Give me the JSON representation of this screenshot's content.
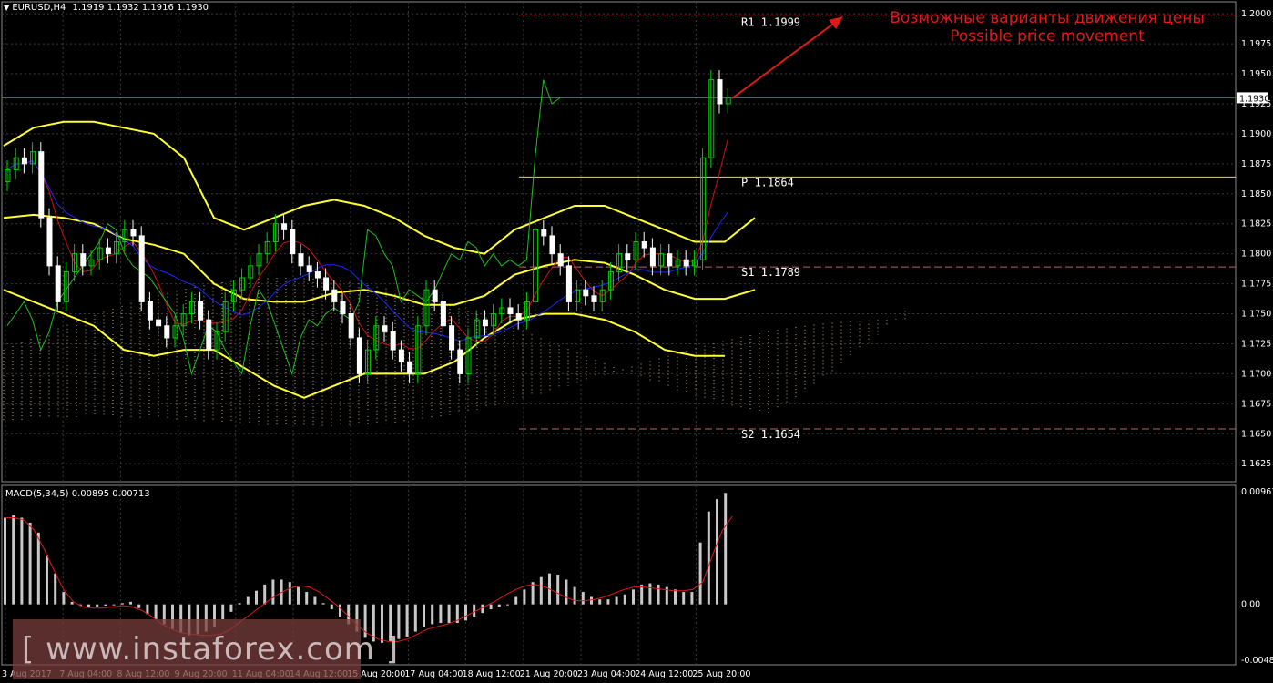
{
  "header": {
    "symbol": "EURUSD,H4",
    "ohlc": "1.1919 1.1932 1.1916 1.1930"
  },
  "annotation": {
    "line1": "Возможные варианты движения цены",
    "line2": "Possible price movement"
  },
  "watermark": "[ www.instaforex.com ]",
  "colors": {
    "background": "#000000",
    "grid": "#3a3a3a",
    "bull": "#00d000",
    "bear": "#ffffff",
    "bollinger": "#ffff33",
    "tenkan": "#d01010",
    "kijun": "#1a28ff",
    "chikou": "#20c020",
    "cloud": "#d8b080",
    "pivot": "#d8d0a0",
    "pivot_r": "#c06060",
    "price_line": "#5a6ab0",
    "macd_hist": "#c8c8c8",
    "macd_signal": "#e01818",
    "annotation": "#e01818"
  },
  "chart_data": [
    {
      "type": "candlestick",
      "title": "EURUSD,H4 1.1919 1.1932 1.1916 1.1930",
      "ylim": [
        1.161,
        1.201
      ],
      "y_ticks": [
        "1.2000",
        "1.1975",
        "1.1950",
        "1.1925",
        "1.1900",
        "1.1875",
        "1.1850",
        "1.1825",
        "1.1800",
        "1.1775",
        "1.1750",
        "1.1725",
        "1.1700",
        "1.1675",
        "1.1650",
        "1.1625"
      ],
      "current_price": "1.1930",
      "x_ticks": [
        "3 Aug 2017",
        "7 Aug 04:00",
        "8 Aug 12:00",
        "9 Aug 20:00",
        "11 Aug 04:00",
        "14 Aug 12:00",
        "15 Aug 20:00",
        "17 Aug 04:00",
        "18 Aug 12:00",
        "21 Aug 20:00",
        "23 Aug 04:00",
        "24 Aug 12:00",
        "25 Aug 20:00"
      ],
      "levels": [
        {
          "name": "R1",
          "label": "R1 1.1999",
          "value": 1.1999
        },
        {
          "name": "P",
          "label": "P 1.1864",
          "value": 1.1864
        },
        {
          "name": "S1",
          "label": "S1 1.1789",
          "value": 1.1789
        },
        {
          "name": "S2",
          "label": "S2 1.1654",
          "value": 1.1654
        }
      ],
      "close": [
        1.187,
        1.188,
        1.1875,
        1.1885,
        1.183,
        1.179,
        1.176,
        1.1785,
        1.18,
        1.179,
        1.1795,
        1.1805,
        1.18,
        1.181,
        1.182,
        1.1815,
        1.176,
        1.1745,
        1.174,
        1.173,
        1.174,
        1.175,
        1.176,
        1.1745,
        1.172,
        1.1735,
        1.176,
        1.177,
        1.178,
        1.179,
        1.18,
        1.181,
        1.1825,
        1.182,
        1.18,
        1.179,
        1.1785,
        1.178,
        1.177,
        1.176,
        1.175,
        1.173,
        1.17,
        1.172,
        1.174,
        1.1735,
        1.172,
        1.171,
        1.17,
        1.174,
        1.177,
        1.176,
        1.174,
        1.172,
        1.17,
        1.173,
        1.1745,
        1.174,
        1.175,
        1.1755,
        1.175,
        1.1745,
        1.176,
        1.182,
        1.1815,
        1.18,
        1.179,
        1.176,
        1.177,
        1.1765,
        1.176,
        1.177,
        1.1785,
        1.18,
        1.1795,
        1.181,
        1.1805,
        1.179,
        1.18,
        1.179,
        1.1795,
        1.179,
        1.1795,
        1.188,
        1.1945,
        1.1925,
        1.193
      ],
      "bollinger_upper": [
        1.189,
        1.1905,
        1.191,
        1.191,
        1.1905,
        1.19,
        1.188,
        1.183,
        1.182,
        1.183,
        1.184,
        1.1845,
        1.184,
        1.183,
        1.1815,
        1.1805,
        1.18,
        1.182,
        1.183,
        1.184,
        1.184,
        1.183,
        1.182,
        1.181,
        1.181,
        1.183
      ],
      "bollinger_lower": [
        1.177,
        1.176,
        1.175,
        1.174,
        1.172,
        1.1715,
        1.172,
        1.172,
        1.1705,
        1.169,
        1.168,
        1.169,
        1.17,
        1.17,
        1.17,
        1.171,
        1.173,
        1.1745,
        1.175,
        1.175,
        1.1745,
        1.1735,
        1.172,
        1.1715,
        1.1715
      ]
    },
    {
      "type": "bar",
      "title": "MACD(5,34,5) 0.00895 0.00713",
      "ylim": [
        -0.00488,
        0.00961
      ],
      "y_ticks": [
        "0.00961",
        "0.00",
        "-0.00488"
      ],
      "series": [
        {
          "values": [
            0.007,
            0.0072,
            0.007,
            0.0066,
            0.0058,
            0.004,
            0.0025,
            0.001,
            0.0002,
            -0.0001,
            -0.0002,
            -0.0002,
            -0.0001,
            0.0,
            0.0001,
            0.0002,
            -0.0003,
            -0.0008,
            -0.0012,
            -0.0016,
            -0.002,
            -0.0023,
            -0.0025,
            -0.0024,
            -0.0022,
            -0.0018,
            -0.0012,
            -0.0006,
            0.0001,
            0.0006,
            0.0011,
            0.0016,
            0.002,
            0.002,
            0.0018,
            0.0014,
            0.001,
            0.0006,
            0.0001,
            -0.0004,
            -0.001,
            -0.0016,
            -0.0022,
            -0.0027,
            -0.003,
            -0.0031,
            -0.003,
            -0.0028,
            -0.0026,
            -0.0022,
            -0.0018,
            -0.0016,
            -0.0015,
            -0.0015,
            -0.0015,
            -0.0013,
            -0.001,
            -0.0007,
            -0.0004,
            -0.0002,
            0.0,
            0.0006,
            0.0012,
            0.0018,
            0.0022,
            0.0025,
            0.0024,
            0.002,
            0.0014,
            0.001,
            0.0006,
            0.0004,
            0.0004,
            0.0006,
            0.0008,
            0.0012,
            0.0016,
            0.0017,
            0.0016,
            0.0014,
            0.0012,
            0.001,
            0.001,
            0.005,
            0.0075,
            0.0085,
            0.009
          ]
        },
        {
          "values": [
            0.007,
            0.007,
            0.0068,
            0.006,
            0.0045,
            0.0028,
            0.0012,
            0.0002,
            -0.0002,
            -0.0003,
            -0.0003,
            -0.0002,
            -0.0001,
            -0.0002,
            -0.0005,
            -0.001,
            -0.0016,
            -0.002,
            -0.0023,
            -0.0024,
            -0.0025,
            -0.0025,
            -0.0024,
            -0.002,
            -0.0014,
            -0.0008,
            -0.0002,
            0.0004,
            0.0009,
            0.0013,
            0.0015,
            0.0014,
            0.001,
            0.0004,
            -0.0002,
            -0.001,
            -0.0018,
            -0.0024,
            -0.0028,
            -0.003,
            -0.003,
            -0.0028,
            -0.0024,
            -0.002,
            -0.0018,
            -0.0016,
            -0.0013,
            -0.0009,
            -0.0005,
            -0.0001,
            0.0003,
            0.0008,
            0.0012,
            0.0015,
            0.0016,
            0.0014,
            0.001,
            0.0006,
            0.0003,
            0.0003,
            0.0004,
            0.0006,
            0.0009,
            0.0012,
            0.0014,
            0.0014,
            0.0013,
            0.0012,
            0.0011,
            0.0011,
            0.0012,
            0.0018,
            0.004,
            0.006,
            0.0071
          ]
        }
      ]
    }
  ]
}
